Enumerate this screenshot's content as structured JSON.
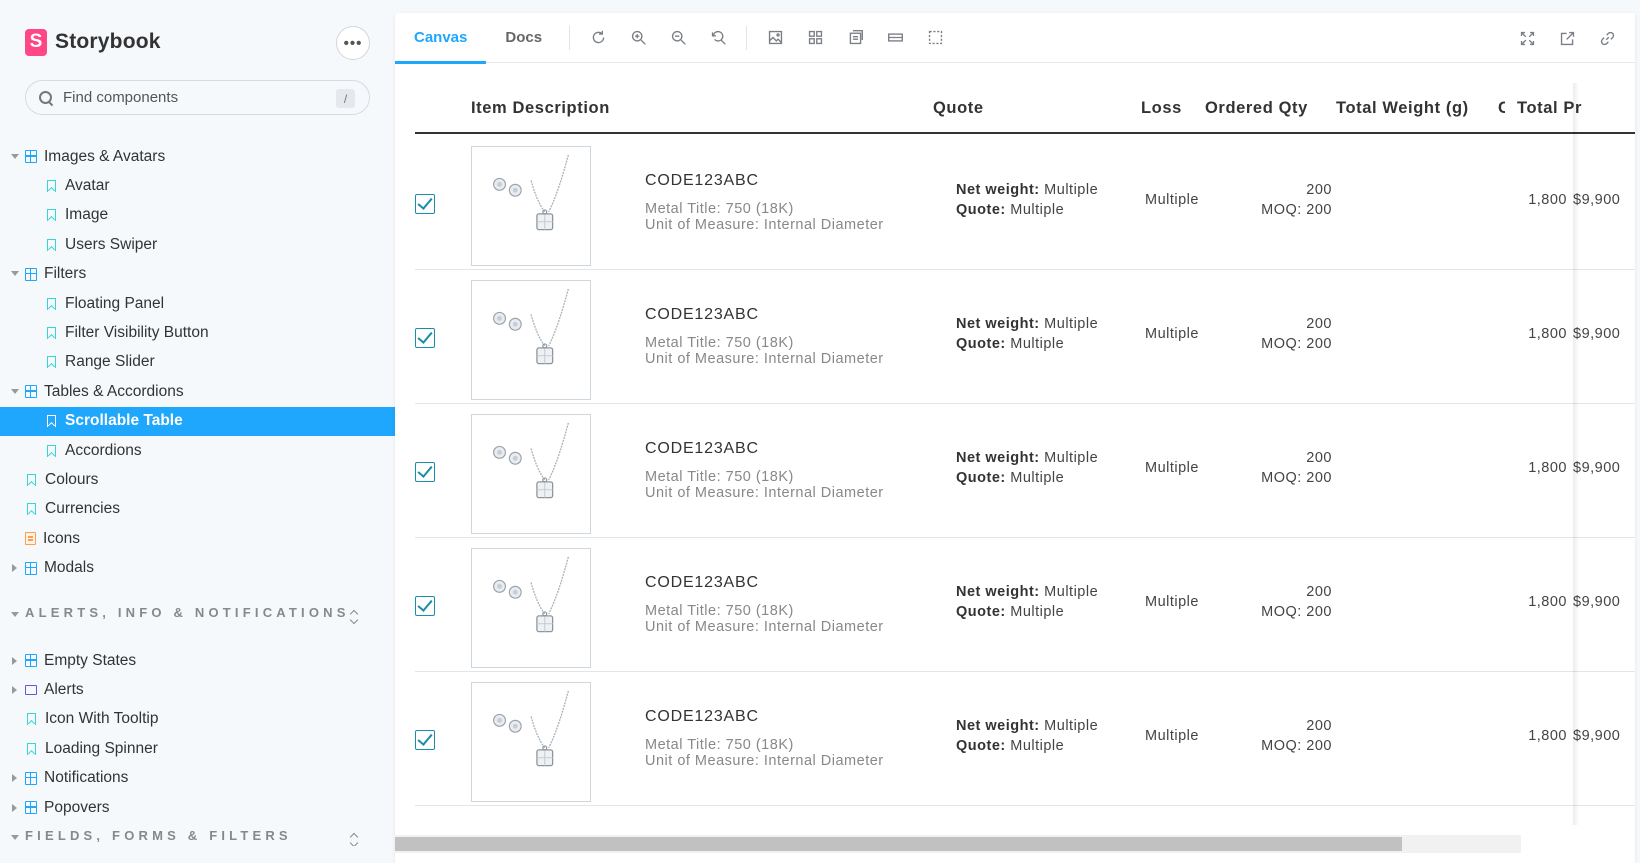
{
  "brand": {
    "name": "Storybook",
    "logo_letter": "S",
    "accent": "#ff4785"
  },
  "sidebar": {
    "menu_label": "•••",
    "search_placeholder": "Find components",
    "search_shortcut": "/",
    "items": [
      {
        "label": "Images & Avatars",
        "icon": "component-icon"
      },
      {
        "label": "Avatar",
        "icon": "story-icon"
      },
      {
        "label": "Image",
        "icon": "story-icon"
      },
      {
        "label": "Users Swiper",
        "icon": "story-icon"
      },
      {
        "label": "Filters",
        "icon": "component-icon"
      },
      {
        "label": "Floating Panel",
        "icon": "story-icon"
      },
      {
        "label": "Filter Visibility Button",
        "icon": "story-icon"
      },
      {
        "label": "Range Slider",
        "icon": "story-icon"
      },
      {
        "label": "Tables & Accordions",
        "icon": "component-icon"
      },
      {
        "label": "Scrollable Table",
        "icon": "story-icon",
        "selected": true
      },
      {
        "label": "Accordions",
        "icon": "story-icon"
      },
      {
        "label": "Colours",
        "icon": "story-icon"
      },
      {
        "label": "Currencies",
        "icon": "story-icon"
      },
      {
        "label": "Icons",
        "icon": "document-icon"
      },
      {
        "label": "Modals",
        "icon": "component-icon"
      }
    ],
    "section2": {
      "title": "ALERTS, INFO & NOTIFICATIONS",
      "items": [
        {
          "label": "Empty States",
          "icon": "component-icon"
        },
        {
          "label": "Alerts",
          "icon": "folder-icon"
        },
        {
          "label": "Icon With Tooltip",
          "icon": "story-icon"
        },
        {
          "label": "Loading Spinner",
          "icon": "story-icon"
        },
        {
          "label": "Notifications",
          "icon": "component-icon"
        },
        {
          "label": "Popovers",
          "icon": "component-icon"
        }
      ]
    },
    "section3_title": "FIELDS, FORMS & FILTERS",
    "selected_color": "#1ea7fd"
  },
  "toolbar": {
    "tabs": [
      {
        "label": "Canvas",
        "active": true
      },
      {
        "label": "Docs",
        "active": false
      }
    ],
    "tools": [
      "reload-icon",
      "zoom-in-icon",
      "zoom-out-icon",
      "reset-zoom-icon",
      "background-icon",
      "grid-icon",
      "viewport-icon",
      "measure-icon",
      "outline-icon"
    ],
    "right_tools": [
      "fullscreen-icon",
      "open-new-tab-icon",
      "copy-link-icon"
    ]
  },
  "table": {
    "headers": {
      "description": "Item Description",
      "quote": "Quote",
      "loss": "Loss",
      "ordered_qty": "Ordered Qty",
      "total_weight": "Total Weight (g)",
      "hidden_col": "C",
      "total_price": "Total Pr"
    },
    "rows": [
      {
        "checked": true,
        "code": "CODE123ABC",
        "metal": "Metal Title: 750 (18K)",
        "uom": "Unit of Measure: Internal Diameter",
        "net_label": "Net weight:",
        "net_value": "Multiple",
        "quote_label": "Quote:",
        "quote_value": "Multiple",
        "loss": "Multiple",
        "qty": "200",
        "moq": "MOQ: 200",
        "weight": "1,800",
        "price": "$9,900"
      },
      {
        "checked": true,
        "code": "CODE123ABC",
        "metal": "Metal Title: 750 (18K)",
        "uom": "Unit of Measure: Internal Diameter",
        "net_label": "Net weight:",
        "net_value": "Multiple",
        "quote_label": "Quote:",
        "quote_value": "Multiple",
        "loss": "Multiple",
        "qty": "200",
        "moq": "MOQ: 200",
        "weight": "1,800",
        "price": "$9,900"
      },
      {
        "checked": true,
        "code": "CODE123ABC",
        "metal": "Metal Title: 750 (18K)",
        "uom": "Unit of Measure: Internal Diameter",
        "net_label": "Net weight:",
        "net_value": "Multiple",
        "quote_label": "Quote:",
        "quote_value": "Multiple",
        "loss": "Multiple",
        "qty": "200",
        "moq": "MOQ: 200",
        "weight": "1,800",
        "price": "$9,900"
      },
      {
        "checked": true,
        "code": "CODE123ABC",
        "metal": "Metal Title: 750 (18K)",
        "uom": "Unit of Measure: Internal Diameter",
        "net_label": "Net weight:",
        "net_value": "Multiple",
        "quote_label": "Quote:",
        "quote_value": "Multiple",
        "loss": "Multiple",
        "qty": "200",
        "moq": "MOQ: 200",
        "weight": "1,800",
        "price": "$9,900"
      },
      {
        "checked": true,
        "code": "CODE123ABC",
        "metal": "Metal Title: 750 (18K)",
        "uom": "Unit of Measure: Internal Diameter",
        "net_label": "Net weight:",
        "net_value": "Multiple",
        "quote_label": "Quote:",
        "quote_value": "Multiple",
        "loss": "Multiple",
        "qty": "200",
        "moq": "MOQ: 200",
        "weight": "1,800",
        "price": "$9,900"
      }
    ]
  }
}
